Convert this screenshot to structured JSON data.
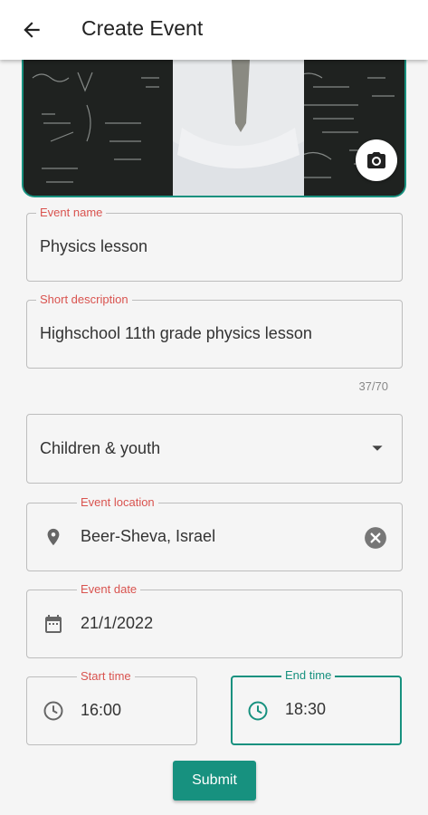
{
  "header": {
    "title": "Create Event",
    "back_icon": "arrow-back-icon"
  },
  "hero": {
    "camera_icon": "camera-icon"
  },
  "form": {
    "event_name": {
      "label": "Event name",
      "value": "Physics lesson"
    },
    "short_description": {
      "label": "Short description",
      "value": "Highschool 11th grade physics lesson",
      "counter": "37/70"
    },
    "category": {
      "value": "Children & youth",
      "icon": "dropdown-arrow-icon"
    },
    "location": {
      "label": "Event location",
      "value": "Beer-Sheva, Israel",
      "icon": "location-pin-icon",
      "clear_icon": "clear-icon"
    },
    "date": {
      "label": "Event date",
      "value": "21/1/2022",
      "icon": "calendar-icon"
    },
    "start_time": {
      "label": "Start time",
      "value": "16:00",
      "icon": "clock-icon"
    },
    "end_time": {
      "label": "End time",
      "value": "18:30",
      "icon": "clock-icon"
    }
  },
  "submit_label": "Submit",
  "colors": {
    "accent": "#17917f",
    "label": "#d9534f"
  }
}
